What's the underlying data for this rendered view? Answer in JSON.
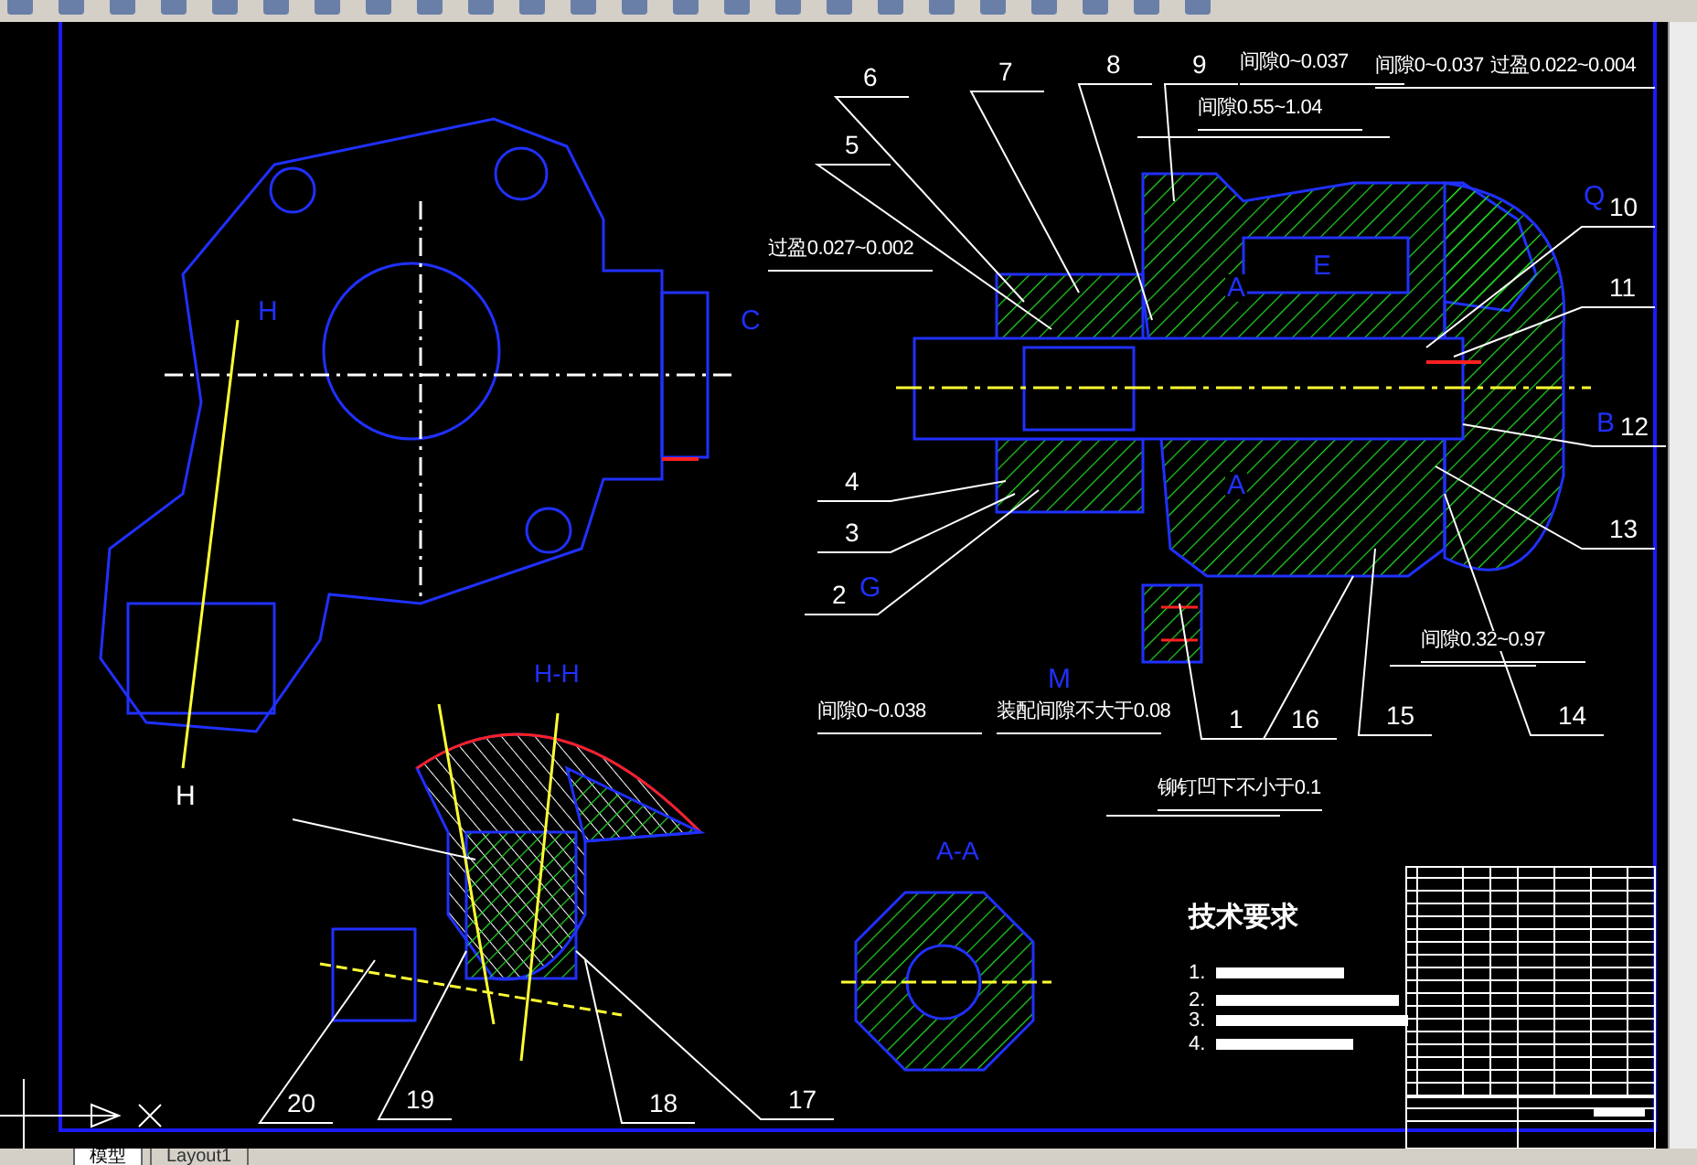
{
  "drawing": {
    "callouts": [
      "6",
      "7",
      "8",
      "9",
      "5",
      "10",
      "11",
      "12",
      "4",
      "3",
      "2",
      "13",
      "1",
      "16",
      "15",
      "14",
      "20",
      "19",
      "18",
      "17"
    ],
    "notes": [
      "间隙0~0.037",
      "间隙0~0.037",
      "过盈0.022~0.004",
      "间隙0.55~1.04",
      "过盈0.027~0.002",
      "间隙0~0.038",
      "装配间隙不大于0.08",
      "铆钉凹下不小于0.1",
      "间隙0.32~0.97"
    ],
    "letters": [
      "A",
      "E",
      "Q",
      "B",
      "C",
      "G",
      "M",
      "A",
      "H",
      "H"
    ],
    "view_titles": [
      "H-H",
      "A-A"
    ]
  },
  "tech_requirements": {
    "title": "技术要求",
    "items": [
      "1.",
      "2.",
      "3.",
      "4."
    ]
  },
  "layout_tabs": [
    {
      "label": "模型",
      "selected": true
    },
    {
      "label": "Layout1",
      "selected": false
    }
  ]
}
